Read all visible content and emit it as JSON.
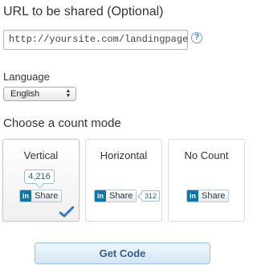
{
  "url_section": {
    "heading": "URL to be shared (Optional)",
    "input_value": "http://yoursite.com/landingpage",
    "help_glyph": "?"
  },
  "language": {
    "label": "Language",
    "selected": "English"
  },
  "count_mode": {
    "heading": "Choose a count mode",
    "modes": [
      {
        "label": "Vertical",
        "selected": true,
        "count": "4,216",
        "button_logo": "in",
        "button_label": "Share"
      },
      {
        "label": "Horizontal",
        "selected": false,
        "count": "312",
        "button_logo": "in",
        "button_label": "Share"
      },
      {
        "label": "No Count",
        "selected": false,
        "count": "",
        "button_logo": "in",
        "button_label": "Share"
      }
    ]
  },
  "actions": {
    "get_code_label": "Get Code"
  },
  "colors": {
    "linkedin_blue": "#0e76a8",
    "check_blue": "#2f78c4",
    "button_text": "#355f86"
  },
  "icons": [
    "help-icon",
    "linkedin-icon",
    "select-arrows-icon",
    "checkmark-icon"
  ]
}
